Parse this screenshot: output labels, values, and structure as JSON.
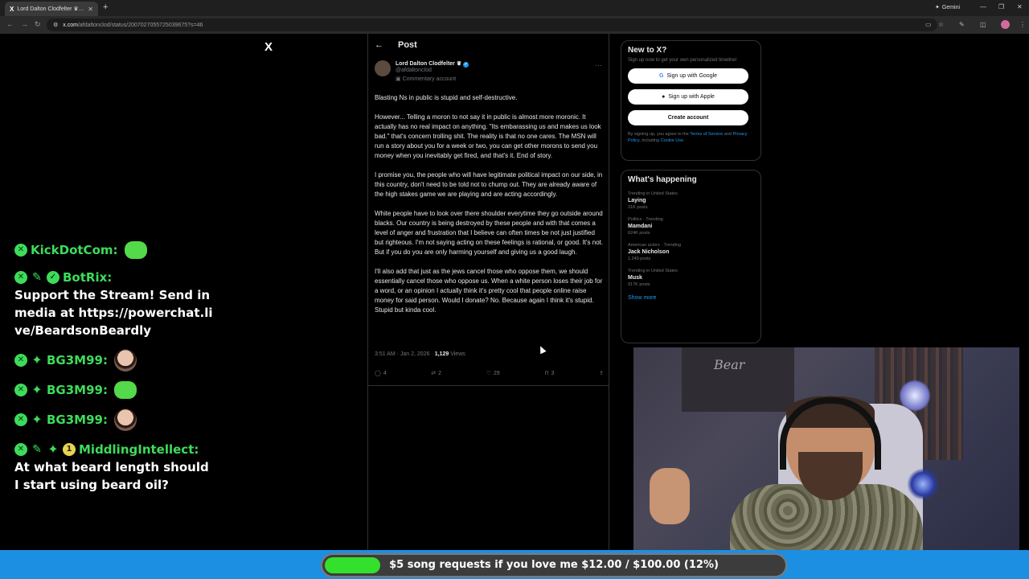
{
  "browser": {
    "tab_title": "Lord Dalton Clodfelter ♛ on X:",
    "new_tab": "+",
    "gemini_label": "Gemini",
    "url_host": "x.com",
    "url_path": "/afdaltonclod/status/2007027055725039675?s=46"
  },
  "x_logo": "X",
  "chat": [
    {
      "badges": [
        "check"
      ],
      "user": "KickDotCom:",
      "emote": "frog",
      "text": ""
    },
    {
      "badges": [
        "check",
        "pen",
        "verified"
      ],
      "user": "BotRix:",
      "emote": "",
      "text": "Support the Stream! Send in media at https://powerchat.live/BeardsonBeardly"
    },
    {
      "badges": [
        "check",
        "spark"
      ],
      "user": "BG3M99:",
      "emote": "face",
      "text": ""
    },
    {
      "badges": [
        "check",
        "spark"
      ],
      "user": "BG3M99:",
      "emote": "frog",
      "text": ""
    },
    {
      "badges": [
        "check",
        "spark"
      ],
      "user": "BG3M99:",
      "emote": "face",
      "text": ""
    },
    {
      "badges": [
        "check",
        "pen",
        "spark",
        "yellow"
      ],
      "user": "MiddlingIntellect:",
      "emote": "",
      "text": "At what beard length should I start using beard oil?"
    }
  ],
  "post": {
    "header": "Post",
    "author_name": "Lord Dalton Clodfelter ♛",
    "handle": "@afdaltonclod",
    "commentary": "Commentary account",
    "paragraphs": [
      "Blasting Ns in public is stupid and self-destructive.",
      "However... Telling a moron to not say it in public is almost more moronic. It actually has no real impact on anything. \"Its embarassing us and makes us look bad.\" that's concern trolling shit. The reality is that no one cares. The MSN will run a story about you for a week or two, you can get other morons to send you money when you inevitably get fired, and that's it. End of story.",
      "I promise you, the people who will have legitimate political impact on our side, in this country, don't need to be told not to chump out. They are already aware of the high stakes game we are playing and are acting accordingly.",
      "White people have to look over there shoulder everytime they go outside around blacks. Our country is being destroyed by these people and with that comes a level of anger and frustration that I believe can often times be not just justified but righteous. I'm not saying acting on these feelings is rational, or good. It's not. But if you do you are only harming yourself and giving us a good laugh.",
      "I'll also add that just as the jews cancel those who oppose them, we should essentially cancel those who oppose us. When a white person loses their job for a word, or an opinion I actually think it's pretty cool that people online raise money for said person. Would I donate? No. Because again I think it's stupid. Stupid but kinda cool."
    ],
    "time": "3:51 AM · Jan 2, 2026 ·",
    "views_count": "1,129",
    "views_label": "Views",
    "replies": "4",
    "reposts": "2",
    "likes": "29",
    "bookmarks": "3"
  },
  "sidebar": {
    "newx_title": "New to X?",
    "newx_sub": "Sign up now to get your own personalized timeline!",
    "google_btn": "Sign up with Google",
    "apple_btn": "Sign up with Apple",
    "create_btn": "Create account",
    "legal_pre": "By signing up, you agree to the",
    "terms": "Terms of Service",
    "and": "and",
    "privacy": "Privacy Policy",
    "including": ", including",
    "cookie": "Cookie Use.",
    "happening_title": "What's happening",
    "trends": [
      {
        "ctx": "Trending in United States",
        "name": "Laying",
        "count": "31K posts"
      },
      {
        "ctx": "Politics · Trending",
        "name": "Mamdani",
        "count": "624K posts"
      },
      {
        "ctx": "American actors · Trending",
        "name": "Jack Nicholson",
        "count": "1,249 posts"
      },
      {
        "ctx": "Trending in United States",
        "name": "Musk",
        "count": "917K posts"
      }
    ],
    "show_more": "Show more"
  },
  "goal": {
    "text": "$5 song requests if you love me $12.00 / $100.00 (12%)",
    "progress": 0.12,
    "fill_color": "#33e02c"
  }
}
